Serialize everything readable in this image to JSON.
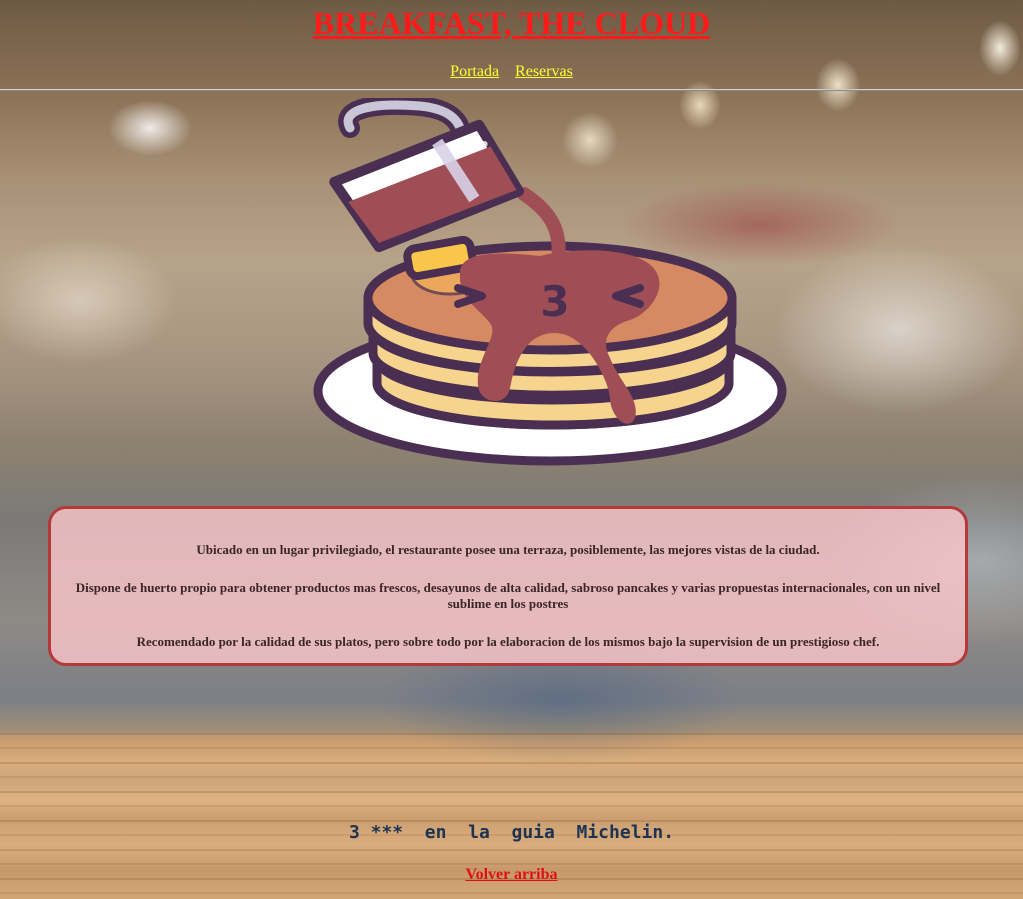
{
  "header": {
    "title": "BREAKFAST, THE CLOUD",
    "nav": [
      {
        "label": "Portada"
      },
      {
        "label": "Reservas"
      }
    ]
  },
  "hero": {
    "icon": "pancakes-syrup-icon",
    "face_text": "3"
  },
  "info": {
    "paragraphs": [
      "Ubicado en un lugar privilegiado, el restaurante posee una terraza, posiblemente, las mejores vistas de la ciudad.",
      "Dispone de huerto propio para obtener productos mas frescos, desayunos de alta calidad, sabroso pancakes y varias propuestas internacionales, con un nivel sublime en los postres",
      "Recomendado por la calidad de sus platos, pero sobre todo por la elaboracion de los mismos bajo la supervision de un prestigioso chef."
    ]
  },
  "footer": {
    "michelin": "3 ***  en  la  guia  Michelin.",
    "back_to_top": "Volver arriba"
  },
  "colors": {
    "title": "#ff1a1a",
    "nav_link": "#ffff33",
    "box_border": "#b23a3a",
    "box_fill": "#ffc8cd",
    "michelin_text": "#1e3352",
    "back_link": "#e01010"
  }
}
